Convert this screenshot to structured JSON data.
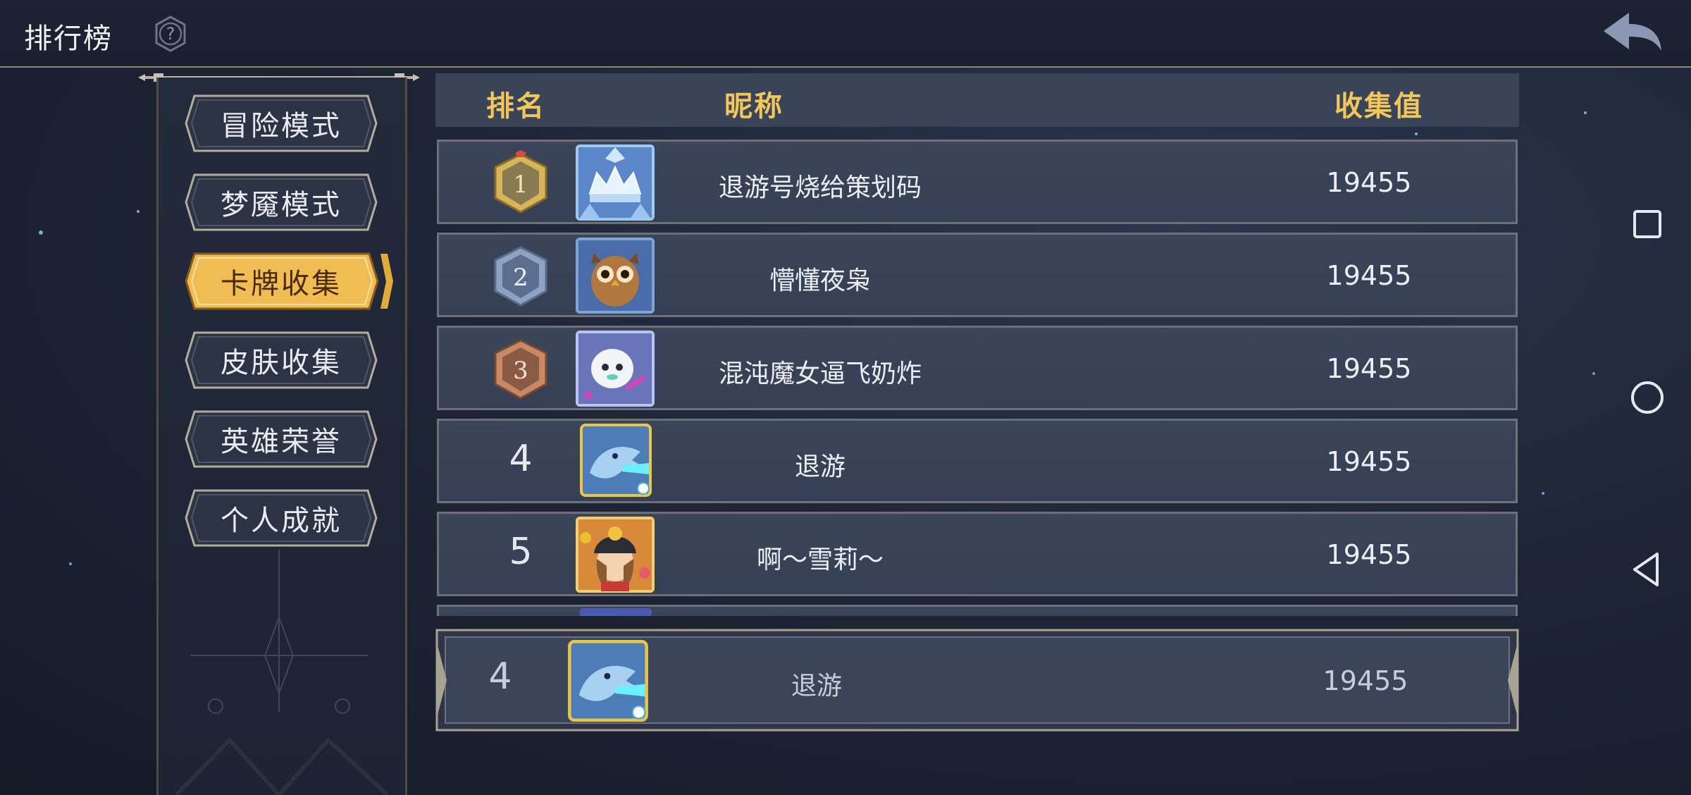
{
  "header": {
    "title": "排行榜"
  },
  "sidebar": {
    "items": [
      {
        "label": "冒险模式",
        "active": false
      },
      {
        "label": "梦魇模式",
        "active": false
      },
      {
        "label": "卡牌收集",
        "active": true
      },
      {
        "label": "皮肤收集",
        "active": false
      },
      {
        "label": "英雄荣誉",
        "active": false
      },
      {
        "label": "个人成就",
        "active": false
      }
    ]
  },
  "table": {
    "columns": {
      "rank": "排名",
      "nickname": "昵称",
      "value": "收集值"
    },
    "rows": [
      {
        "rank": "1",
        "nickname": "退游号烧给策划码",
        "value": "19455",
        "avatar": "frost-crown-avatar"
      },
      {
        "rank": "2",
        "nickname": "懵懂夜枭",
        "value": "19455",
        "avatar": "owl-avatar"
      },
      {
        "rank": "3",
        "nickname": "混沌魔女逼飞奶炸",
        "value": "19455",
        "avatar": "white-creature-avatar"
      },
      {
        "rank": "4",
        "nickname": "退游",
        "value": "19455",
        "avatar": "ice-dragon-avatar"
      },
      {
        "rank": "5",
        "nickname": "啊～雪莉～",
        "value": "19455",
        "avatar": "hat-girl-avatar"
      }
    ]
  },
  "my_rank": {
    "rank": "4",
    "nickname": "退游",
    "value": "19455",
    "avatar": "ice-dragon-avatar"
  },
  "colors": {
    "header_gold": "#f1c65a",
    "row_bg": "#3b4559",
    "active_tab": "#e8b84a"
  }
}
